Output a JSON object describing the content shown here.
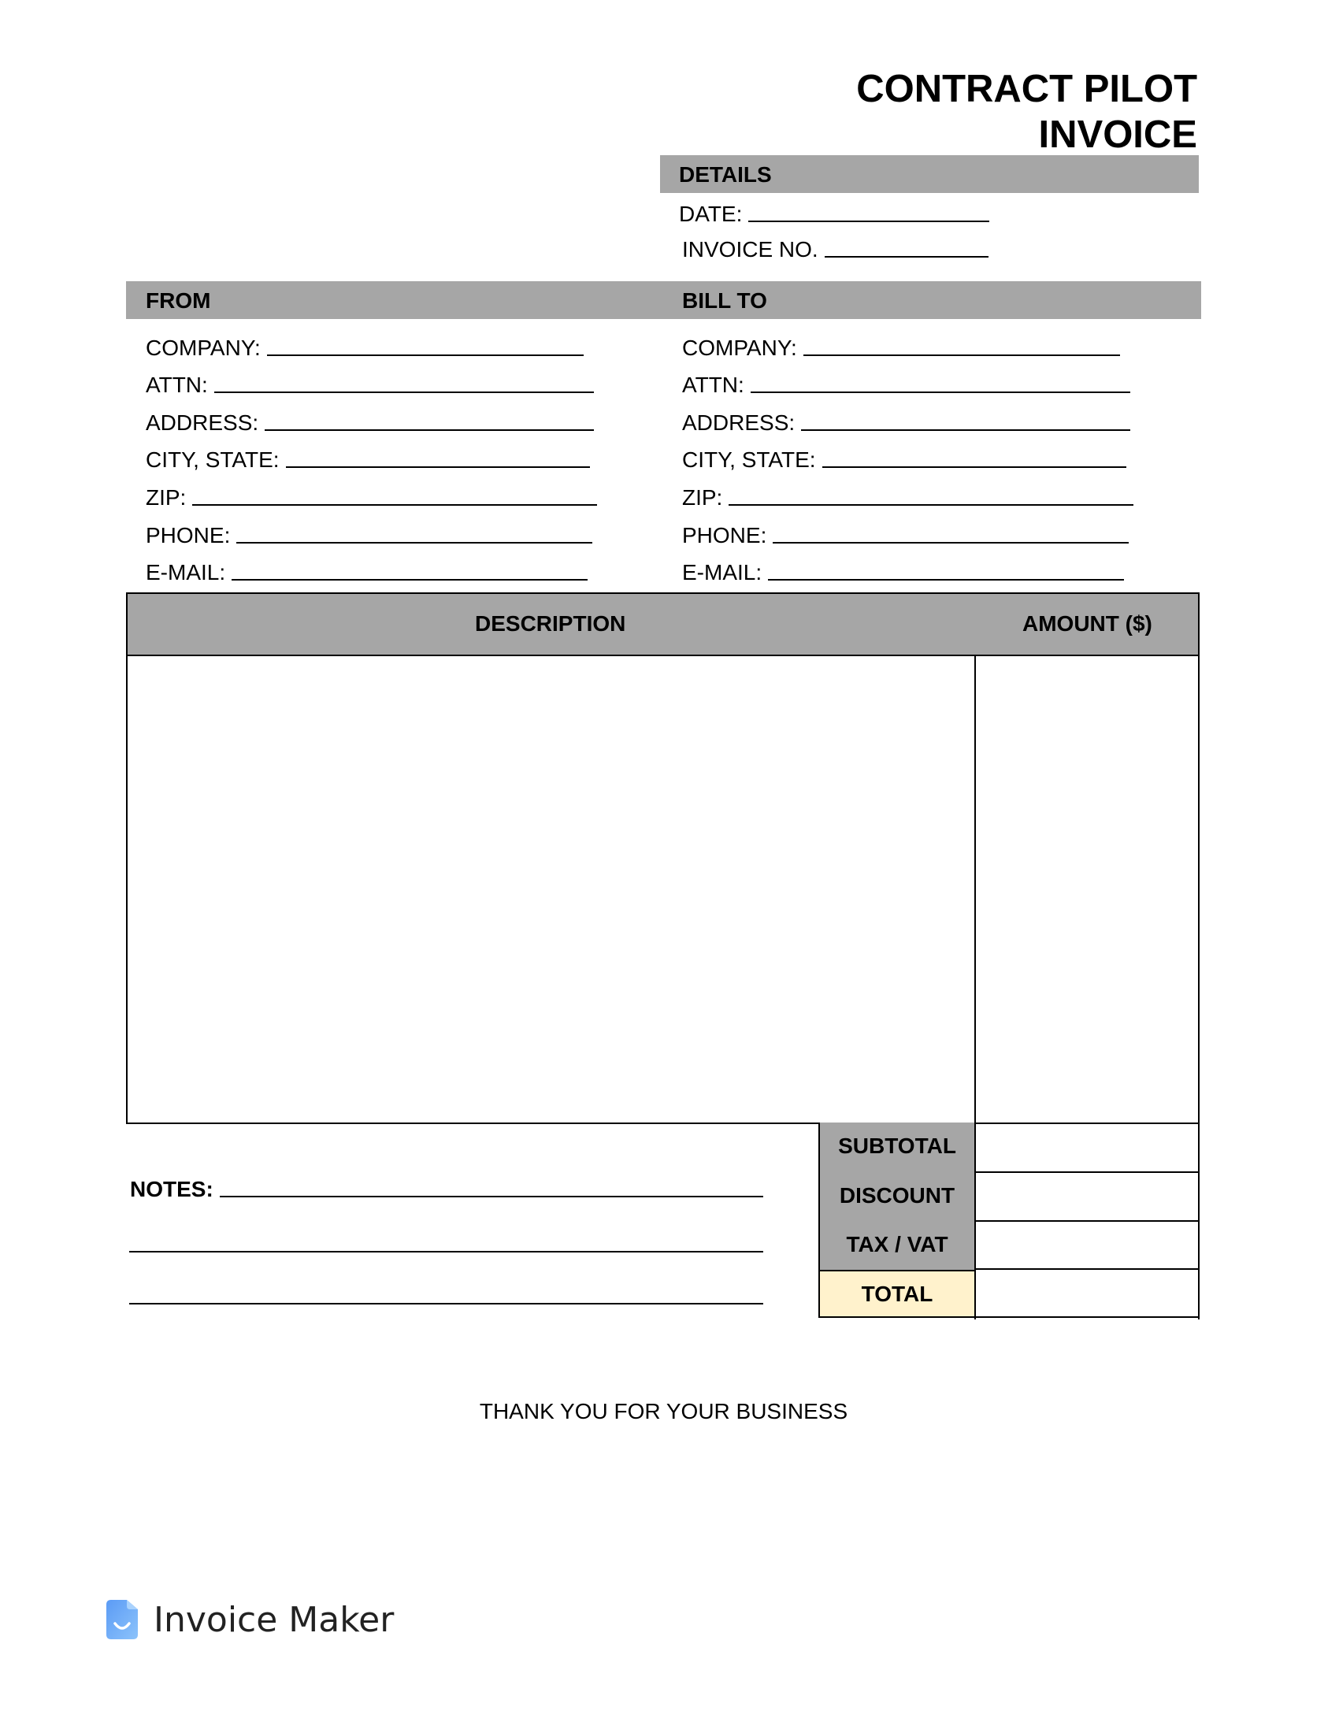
{
  "title": {
    "line1": "CONTRACT PILOT",
    "line2": "INVOICE"
  },
  "details": {
    "heading": "DETAILS",
    "date_label": "DATE:",
    "date_value": "",
    "invoice_no_label": "INVOICE NO.",
    "invoice_no_value": ""
  },
  "from": {
    "heading": "FROM",
    "fields": [
      {
        "label": "COMPANY:",
        "value": ""
      },
      {
        "label": "ATTN:",
        "value": ""
      },
      {
        "label": "ADDRESS:",
        "value": ""
      },
      {
        "label": "CITY, STATE:",
        "value": ""
      },
      {
        "label": "ZIP:",
        "value": ""
      },
      {
        "label": "PHONE:",
        "value": ""
      },
      {
        "label": "E-MAIL:",
        "value": ""
      }
    ]
  },
  "bill_to": {
    "heading": "BILL TO",
    "fields": [
      {
        "label": "COMPANY:",
        "value": ""
      },
      {
        "label": "ATTN:",
        "value": ""
      },
      {
        "label": "ADDRESS:",
        "value": ""
      },
      {
        "label": "CITY, STATE:",
        "value": ""
      },
      {
        "label": "ZIP:",
        "value": ""
      },
      {
        "label": "PHONE:",
        "value": ""
      },
      {
        "label": "E-MAIL:",
        "value": ""
      }
    ]
  },
  "table": {
    "headers": {
      "description": "DESCRIPTION",
      "amount": "AMOUNT ($)"
    },
    "rows": []
  },
  "totals": {
    "subtotal_label": "SUBTOTAL",
    "subtotal_value": "",
    "discount_label": "DISCOUNT",
    "discount_value": "",
    "tax_label": "TAX / VAT",
    "tax_value": "",
    "total_label": "TOTAL",
    "total_value": ""
  },
  "notes": {
    "label": "NOTES:",
    "value": ""
  },
  "footer": {
    "thank_you": "THANK YOU FOR YOUR BUSINESS"
  },
  "brand": {
    "name": "Invoice Maker",
    "icon": "document-smile-icon"
  },
  "colors": {
    "header_gray": "#a6a6a6",
    "total_highlight": "#fff2cc",
    "brand_blue": "#6aa8f7"
  }
}
